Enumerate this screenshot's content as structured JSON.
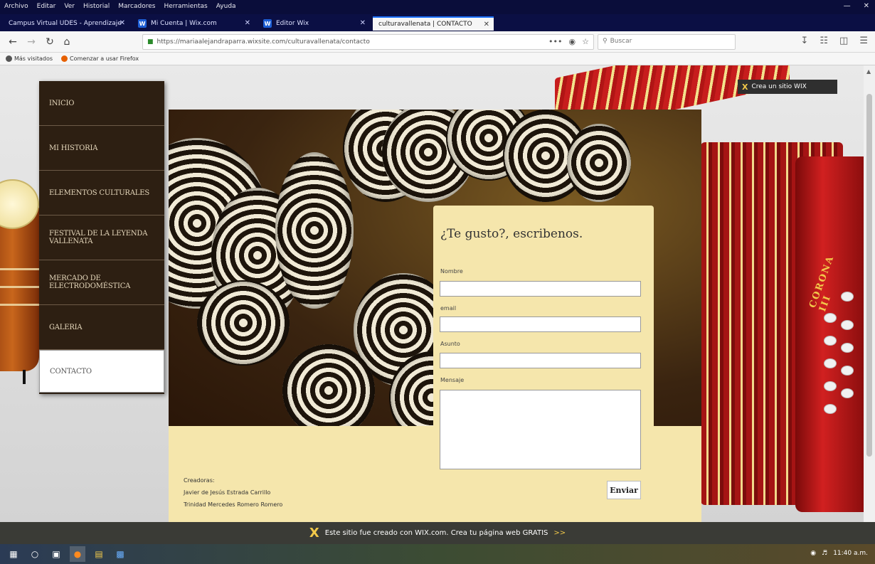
{
  "menubar": {
    "items": [
      "Archivo",
      "Editar",
      "Ver",
      "Historial",
      "Marcadores",
      "Herramientas",
      "Ayuda"
    ]
  },
  "tabs": [
    {
      "label": "Campus Virtual UDES - Aprendizaje",
      "favicon": "campus-icon"
    },
    {
      "label": "Mi Cuenta | Wix.com",
      "favicon": "wix-icon"
    },
    {
      "label": "Editor Wix",
      "favicon": "wix-icon"
    },
    {
      "label": "culturavallenata | CONTACTO",
      "favicon": "page-icon",
      "active": true
    }
  ],
  "urlbar": {
    "url": "https://mariaalejandraparra.wixsite.com/culturavallenata/contacto",
    "more": "•••"
  },
  "searchbar": {
    "placeholder": "Buscar"
  },
  "bookmarks": [
    "Más visitados",
    "Comenzar a usar Firefox"
  ],
  "site": {
    "menu": [
      {
        "label": "INICIO"
      },
      {
        "label": "MI HISTORIA"
      },
      {
        "label": "ELEMENTOS CULTURALES"
      },
      {
        "label": "FESTIVAL DE LA LEYENDA VALLENATA"
      },
      {
        "label": "MERCADO DE ELECTRODOMÉSTICA"
      },
      {
        "label": "GALERIA"
      },
      {
        "label": "CONTACTO",
        "active": true
      }
    ],
    "wix_create_site": "Crea un sitio WIX",
    "accordion_brand": "CORONA III",
    "form": {
      "title": "¿Te gusto?, escribenos.",
      "fields": [
        {
          "label": "Nombre",
          "value": ""
        },
        {
          "label": "email",
          "value": ""
        },
        {
          "label": "Asunto",
          "value": ""
        },
        {
          "label": "Mensaje",
          "value": ""
        }
      ],
      "submit": "Enviar"
    },
    "credits": {
      "heading": "Creadoras:",
      "people": [
        "Javier de Jesús Estrada Carrillo",
        "Trinidad Mercedes Romero Romero"
      ]
    }
  },
  "wix_banner": {
    "text": "Este sitio fue creado con WIX.com. Crea tu página web GRATIS",
    "link": ">>"
  },
  "taskbar": {
    "clock": "11:40 a.m."
  },
  "colors": {
    "menu_bg": "#2d1f12",
    "form_bg": "#f5e6ac",
    "browser_frame": "#0b0f44",
    "wix_accent": "#f2c94a"
  }
}
